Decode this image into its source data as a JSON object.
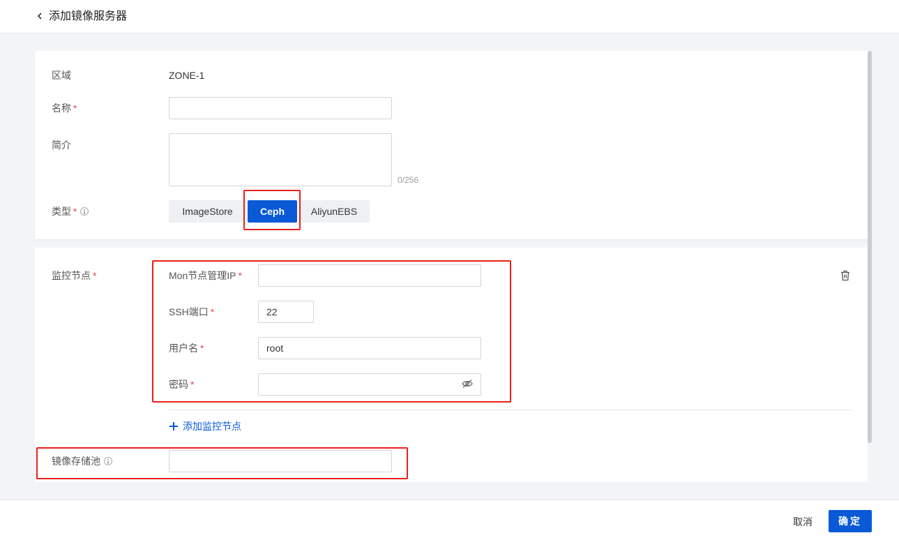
{
  "header": {
    "title": "添加镜像服务器"
  },
  "form": {
    "zone": {
      "label": "区域",
      "value": "ZONE-1"
    },
    "name": {
      "label": "名称",
      "required_mark": "*",
      "value": "",
      "placeholder": ""
    },
    "description": {
      "label": "简介",
      "value": "",
      "counter": "0/256"
    },
    "type": {
      "label": "类型",
      "required_mark": "*",
      "options": [
        "ImageStore",
        "Ceph",
        "AliyunEBS"
      ],
      "selected": "Ceph"
    },
    "monitor": {
      "label": "监控节点",
      "required_mark": "*",
      "mon_ip": {
        "label": "Mon节点管理IP",
        "required_mark": "*",
        "value": ""
      },
      "ssh_port": {
        "label": "SSH端口",
        "required_mark": "*",
        "value": "22"
      },
      "username": {
        "label": "用户名",
        "required_mark": "*",
        "value": "root"
      },
      "password": {
        "label": "密码",
        "required_mark": "*",
        "value": ""
      },
      "add_label": "添加监控节点"
    },
    "pool": {
      "label": "镜像存储池",
      "value": ""
    }
  },
  "footer": {
    "cancel_label": "取消",
    "ok_label": "确定"
  },
  "colors": {
    "primary": "#0a59d6",
    "required": "#e5484d",
    "highlight_box": "#e8201a"
  },
  "icons": [
    "back-arrow-icon",
    "info-icon",
    "trash-icon",
    "eye-off-icon",
    "plus-icon"
  ]
}
